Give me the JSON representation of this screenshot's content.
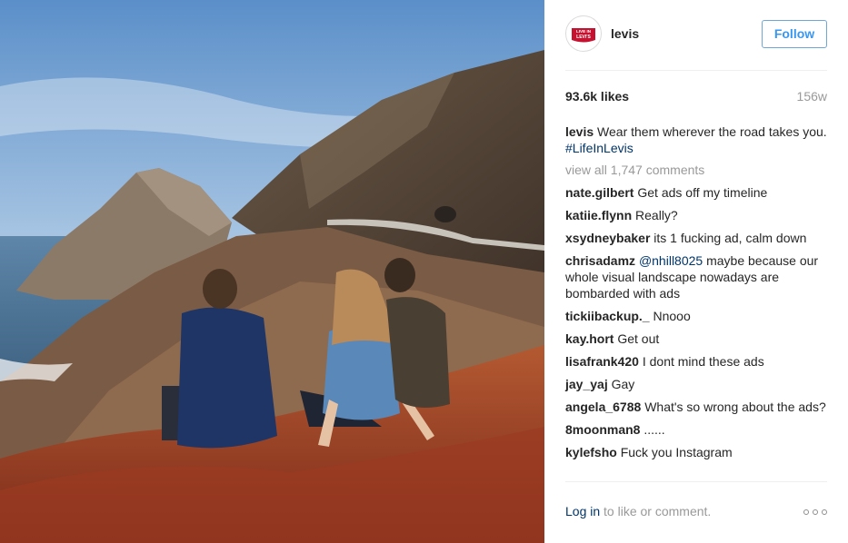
{
  "post": {
    "username": "levis",
    "follow_label": "Follow",
    "likes": "93.6k likes",
    "age": "156w",
    "avatar_logo_text": [
      "LIVE IN",
      "LEVI'S"
    ],
    "caption": {
      "user": "levis",
      "text": "Wear them wherever the road takes you.",
      "hashtag": "#LifeInLevis"
    },
    "view_all": "view all 1,747 comments",
    "comments": [
      {
        "user": "nate.gilbert",
        "text": "Get ads off my timeline"
      },
      {
        "user": "katiie.flynn",
        "text": "Really?"
      },
      {
        "user": "xsydneybaker",
        "text": "its 1 fucking ad, calm down"
      },
      {
        "user": "chrisadamz",
        "mention": "@nhill8025",
        "text": "maybe because our whole visual landscape nowadays are bombarded with ads"
      },
      {
        "user": "tickiibackup._",
        "text": "Nnooo"
      },
      {
        "user": "kay.hort",
        "text": "Get out"
      },
      {
        "user": "lisafrank420",
        "text": "I dont mind these ads"
      },
      {
        "user": "jay_yaj",
        "text": "Gay"
      },
      {
        "user": "angela_6788",
        "text": "What's so wrong about the ads?"
      },
      {
        "user": "8moonman8",
        "text": "......"
      },
      {
        "user": "kylefsho",
        "text": "Fuck you Instagram"
      }
    ],
    "login_link": "Log in",
    "login_suffix": "to like or comment.",
    "more_icon": "more-dots-icon"
  },
  "colors": {
    "link": "#003569",
    "follow_text": "#3897f0",
    "muted": "#999999",
    "brand_red": "#c41230"
  }
}
